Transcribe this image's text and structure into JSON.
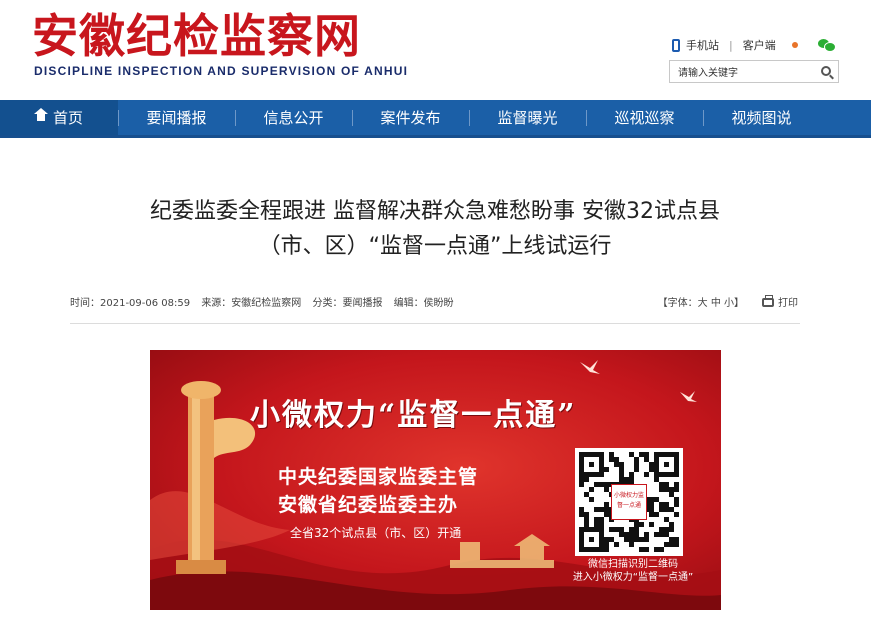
{
  "header": {
    "logo_cn": "安徽纪检监察网",
    "logo_en": "DISCIPLINE INSPECTION AND SUPERVISION OF ANHUI",
    "mobile_label": "手机站",
    "client_label": "客户端",
    "search_placeholder": "请输入关键字"
  },
  "nav": {
    "items": [
      {
        "label": "首页"
      },
      {
        "label": "要闻播报"
      },
      {
        "label": "信息公开"
      },
      {
        "label": "案件发布"
      },
      {
        "label": "监督曝光"
      },
      {
        "label": "巡视巡察"
      },
      {
        "label": "视频图说"
      }
    ]
  },
  "article": {
    "title_line1": "纪委监委全程跟进 监督解决群众急难愁盼事 安徽32试点县",
    "title_line2": "（市、区）“监督一点通”上线试运行",
    "meta": {
      "time": "时间：2021-09-06 08:59",
      "source": "来源：安徽纪检监察网",
      "category": "分类：要闻播报",
      "editor": "编辑：侯盼盼",
      "font_label": "【字体：大 中 小】",
      "print_label": "打印"
    }
  },
  "banner": {
    "title": "小微权力“监督一点通”",
    "line1": "中央纪委国家监委主管",
    "line2": "安徽省纪委监委主办",
    "line3": "全省32个试点县（市、区）开通",
    "qr_center": "小微权力监督一点通",
    "qr_caption1": "微信扫描识别二维码",
    "qr_caption2": "进入小微权力“监督一点通”"
  },
  "colors": {
    "brand_red": "#c8161d",
    "nav_blue": "#1b5fa7",
    "nav_active": "#13508f"
  }
}
